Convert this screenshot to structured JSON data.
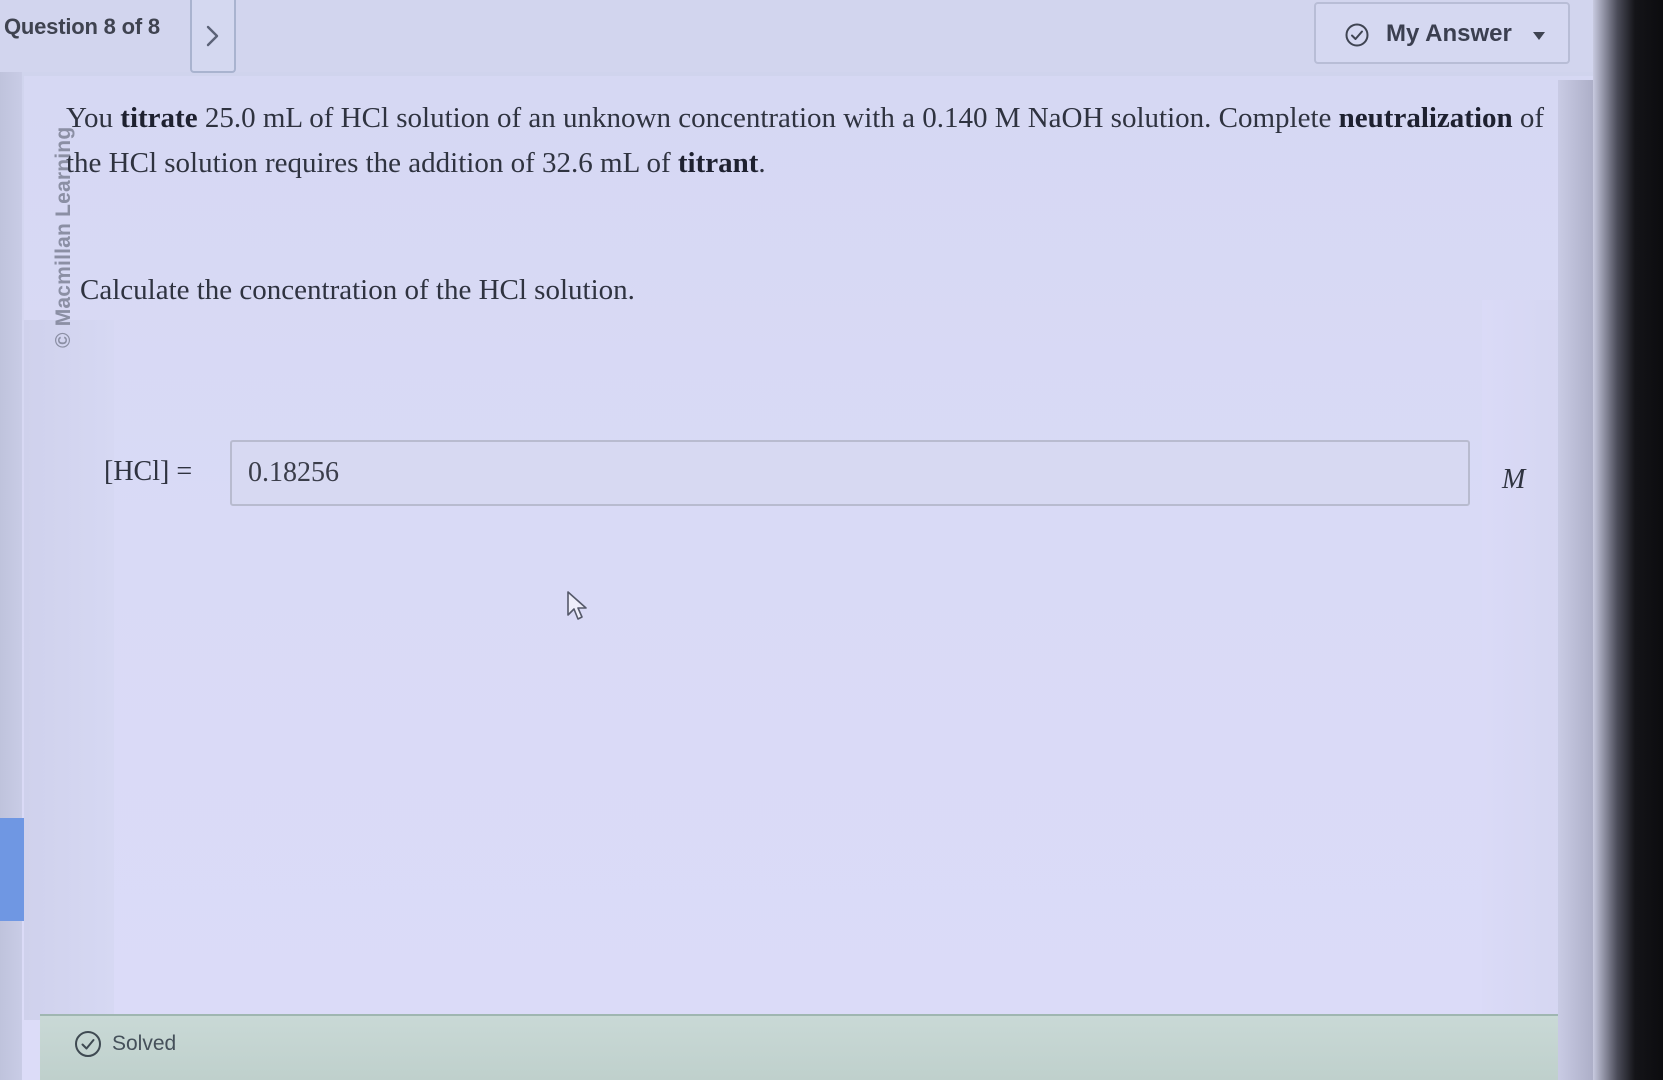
{
  "header": {
    "question_counter": "Question 8 of 8",
    "next_icon": "chevron-right-icon",
    "my_answer_label": "My Answer",
    "my_answer_icon": "check-circle-icon",
    "dropdown_icon": "caret-down-icon"
  },
  "watermark": "© Macmillan Learning",
  "question": {
    "part1": "You ",
    "bold1": "titrate",
    "part2": " 25.0 mL of HCl solution of an unknown concentration with a 0.140 M NaOH solution. Complete ",
    "bold2": "neutralization",
    "part3": " of the HCl solution requires the addition of 32.6 mL of ",
    "bold3": "titrant",
    "part4": ".",
    "prompt": "Calculate the concentration of the HCl solution."
  },
  "answer": {
    "label": "[HCl] =",
    "value": "0.18256",
    "unit": "M"
  },
  "status": {
    "label": "Solved",
    "icon": "check-circle-icon"
  },
  "colors": {
    "background": "#d7d9f3",
    "status_bar": "#c5d6d2",
    "text": "#2f3340"
  }
}
